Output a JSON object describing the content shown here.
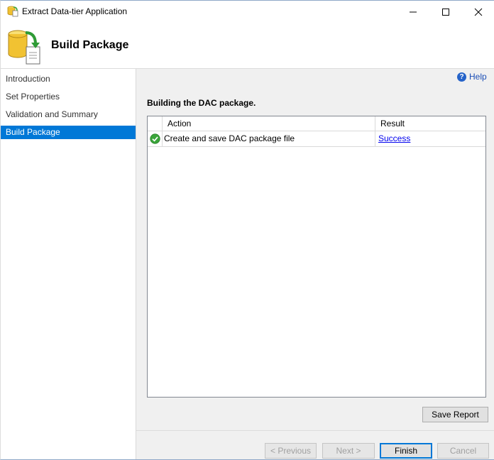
{
  "window": {
    "title": "Extract Data-tier Application",
    "controls": {
      "minimize": "—",
      "maximize": "☐",
      "close": "✕"
    }
  },
  "header": {
    "title": "Build Package"
  },
  "sidebar": {
    "items": [
      {
        "label": "Introduction",
        "active": false
      },
      {
        "label": "Set Properties",
        "active": false
      },
      {
        "label": "Validation and Summary",
        "active": false
      },
      {
        "label": "Build Package",
        "active": true
      }
    ]
  },
  "main": {
    "help_label": "Help",
    "section_label": "Building the DAC package.",
    "table": {
      "columns": [
        "Action",
        "Result"
      ],
      "rows": [
        {
          "status_icon": "success-check-icon",
          "action": "Create and save DAC package file",
          "result": "Success"
        }
      ]
    },
    "save_report_label": "Save Report"
  },
  "footer": {
    "previous_label": "< Previous",
    "next_label": "Next >",
    "finish_label": "Finish",
    "cancel_label": "Cancel"
  },
  "colors": {
    "accent": "#0078d7",
    "link": "#0000ee",
    "success": "#3aa53a"
  }
}
